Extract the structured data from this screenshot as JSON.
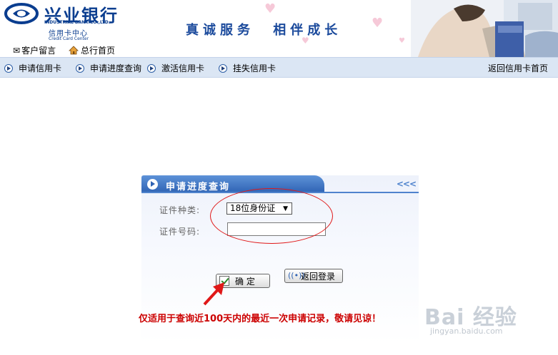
{
  "header": {
    "logo_cn": "兴业银行",
    "logo_en": "INDUSTRIAL BANK CO.,LTD.",
    "logo_sub": "信用卡中心",
    "logo_sub_en": "Credit Card Center",
    "slogan_left": "真诚服务",
    "slogan_right": "相伴成长",
    "quick_links": {
      "message": "客户留言",
      "home": "总行首页"
    }
  },
  "nav": {
    "items": [
      {
        "label": "申请信用卡"
      },
      {
        "label": "申请进度查询"
      },
      {
        "label": "激活信用卡"
      },
      {
        "label": "挂失信用卡"
      }
    ],
    "right": "返回信用卡首页"
  },
  "panel": {
    "title": "申请进度查询",
    "deco": "<<<",
    "id_type_label": "证件种类:",
    "id_type_value": "18位身份证",
    "id_number_label": "证件号码:",
    "id_number_value": "",
    "confirm_label": "确 定",
    "back_label": "返回登录",
    "notice": "仅适用于查询近100天内的最近一次申请记录，敬请见谅！"
  },
  "watermark": {
    "logo": "Bai 经验",
    "url": "jingyan.baidu.com"
  },
  "colors": {
    "brand_blue": "#0a3d8f",
    "nav_bg": "#dbe6f4",
    "panel_header": "#2e62b3",
    "notice_red": "#cc0000",
    "annotation_red": "#e01818"
  }
}
